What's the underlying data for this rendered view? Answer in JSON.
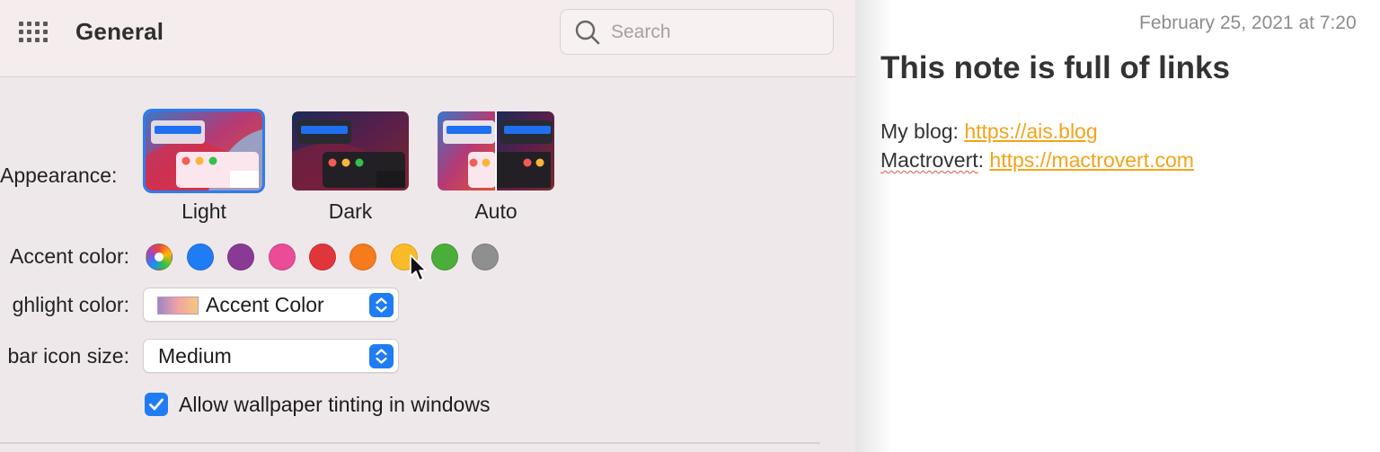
{
  "preferences": {
    "title": "General",
    "search": {
      "placeholder": "Search",
      "value": ""
    },
    "icons": {
      "grid": "show-all-grid-icon",
      "search": "search-icon"
    },
    "appearance": {
      "label": "Appearance:",
      "options": [
        {
          "label": "Light",
          "selected": true
        },
        {
          "label": "Dark",
          "selected": false
        },
        {
          "label": "Auto",
          "selected": false
        }
      ]
    },
    "accent": {
      "label": "Accent color:",
      "colors": [
        {
          "name": "multicolor",
          "hex": "multicolor"
        },
        {
          "name": "blue",
          "hex": "#1f7cf4"
        },
        {
          "name": "purple",
          "hex": "#8a3a94"
        },
        {
          "name": "pink",
          "hex": "#ea4c97"
        },
        {
          "name": "red",
          "hex": "#e0363b"
        },
        {
          "name": "orange",
          "hex": "#f57b1d"
        },
        {
          "name": "yellow",
          "hex": "#fbbb28"
        },
        {
          "name": "green",
          "hex": "#4cae3a"
        },
        {
          "name": "graphite",
          "hex": "#8f8f8f"
        }
      ],
      "hovered": "yellow"
    },
    "highlight": {
      "label": "ghlight color:",
      "value": "Accent Color"
    },
    "icon_size": {
      "label": "bar icon size:",
      "value": "Medium"
    },
    "tinting": {
      "label": "Allow wallpaper tinting in windows",
      "checked": true
    }
  },
  "note": {
    "date": "February 25, 2021 at 7:20",
    "title": "This note is full of links",
    "lines": [
      {
        "prefix": "My blog: ",
        "link": "https://ais.blog"
      },
      {
        "prefix": "Mactrovert",
        "sep": ": ",
        "link": "https://mactrovert.com"
      }
    ],
    "link_color": "#f4a318"
  }
}
